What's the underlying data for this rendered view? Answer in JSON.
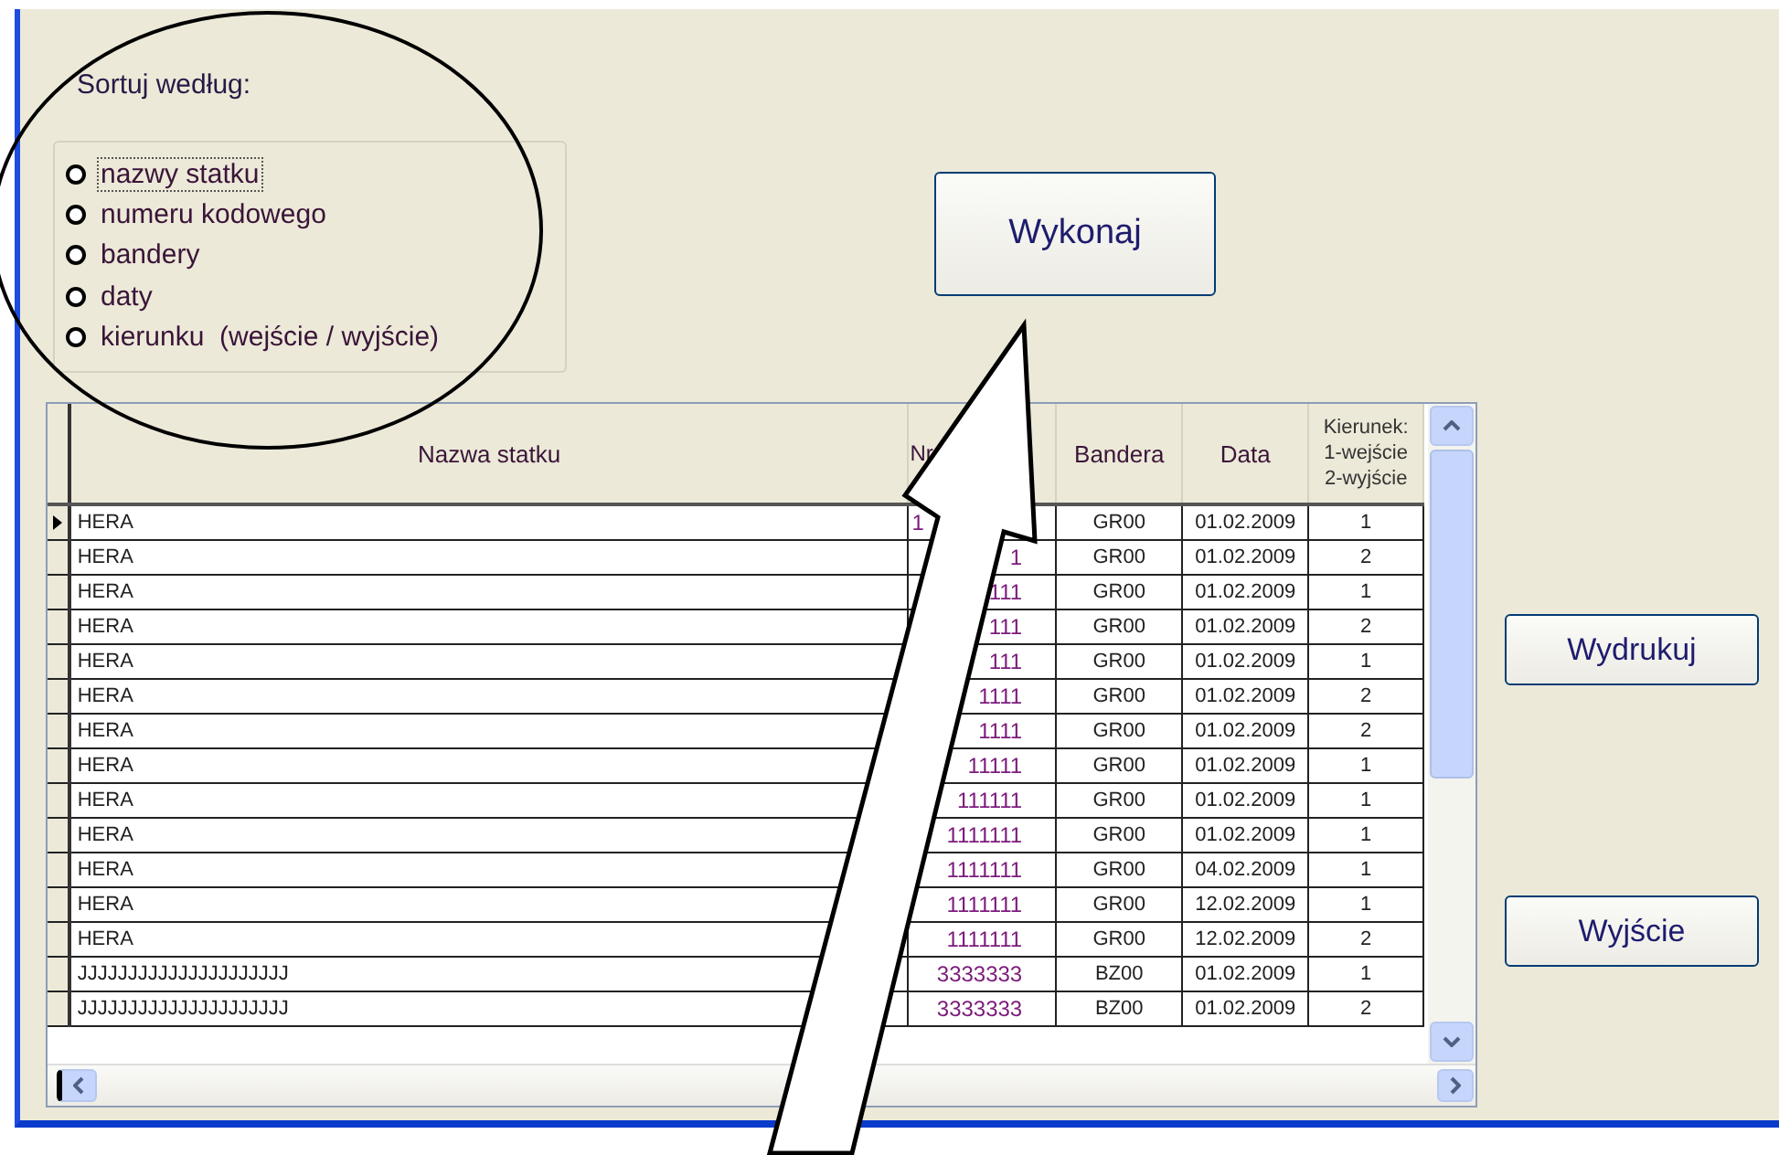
{
  "sort": {
    "label": "Sortuj według:",
    "options": [
      {
        "label": "nazwy statku",
        "selected": false,
        "focused": true
      },
      {
        "label": "numeru kodowego",
        "selected": false,
        "focused": false
      },
      {
        "label": "bandery",
        "selected": false,
        "focused": false
      },
      {
        "label": "daty",
        "selected": false,
        "focused": false
      },
      {
        "label": "kierunku  (wejście / wyjście)",
        "selected": false,
        "focused": false
      }
    ]
  },
  "run_button": "Wykonaj",
  "table": {
    "columns": [
      "Nazwa statku",
      "Nr",
      "Bandera",
      "Data",
      "Kierunek:\n1-wejście\n2-wyjście"
    ],
    "rows": [
      {
        "current": true,
        "cells": [
          "HERA",
          {
            "text": "1",
            "kind": "lead"
          },
          "GR00",
          "01.02.2009",
          "1"
        ]
      },
      {
        "current": false,
        "cells": [
          "HERA",
          {
            "text": "1",
            "kind": "tail"
          },
          "GR00",
          "01.02.2009",
          "2"
        ]
      },
      {
        "current": false,
        "cells": [
          "HERA",
          {
            "text": "111",
            "kind": "tail"
          },
          "GR00",
          "01.02.2009",
          "1"
        ]
      },
      {
        "current": false,
        "cells": [
          "HERA",
          {
            "text": "111",
            "kind": "tail"
          },
          "GR00",
          "01.02.2009",
          "2"
        ]
      },
      {
        "current": false,
        "cells": [
          "HERA",
          {
            "text": "111",
            "kind": "tail"
          },
          "GR00",
          "01.02.2009",
          "1"
        ]
      },
      {
        "current": false,
        "cells": [
          "HERA",
          {
            "text": "1111",
            "kind": "tail"
          },
          "GR00",
          "01.02.2009",
          "2"
        ]
      },
      {
        "current": false,
        "cells": [
          "HERA",
          {
            "text": "1111",
            "kind": "tail"
          },
          "GR00",
          "01.02.2009",
          "2"
        ]
      },
      {
        "current": false,
        "cells": [
          "HERA",
          {
            "text": "11111",
            "kind": "tail"
          },
          "GR00",
          "01.02.2009",
          "1"
        ]
      },
      {
        "current": false,
        "cells": [
          "HERA",
          {
            "text": "111111",
            "kind": "tail"
          },
          "GR00",
          "01.02.2009",
          "1"
        ]
      },
      {
        "current": false,
        "cells": [
          "HERA",
          {
            "text": "1111111",
            "kind": "tail"
          },
          "GR00",
          "01.02.2009",
          "1"
        ]
      },
      {
        "current": false,
        "cells": [
          "HERA",
          {
            "text": "1111111",
            "kind": "tail"
          },
          "GR00",
          "04.02.2009",
          "1"
        ]
      },
      {
        "current": false,
        "cells": [
          "HERA",
          {
            "text": "1111111",
            "kind": "tail"
          },
          "GR00",
          "12.02.2009",
          "1"
        ]
      },
      {
        "current": false,
        "cells": [
          "HERA",
          {
            "text": "1111111",
            "kind": "tail"
          },
          "GR00",
          "12.02.2009",
          "2"
        ]
      },
      {
        "current": false,
        "cells": [
          "JJJJJJJJJJJJJJJJJJJJJ",
          {
            "text": "3333333",
            "kind": "tail"
          },
          "BZ00",
          "01.02.2009",
          "1"
        ]
      },
      {
        "current": false,
        "cells": [
          "JJJJJJJJJJJJJJJJJJJJJ",
          {
            "text": "3333333",
            "kind": "tail"
          },
          "BZ00",
          "01.02.2009",
          "2"
        ]
      }
    ]
  },
  "side_buttons": [
    "Wydrukuj",
    "Wyjście"
  ]
}
